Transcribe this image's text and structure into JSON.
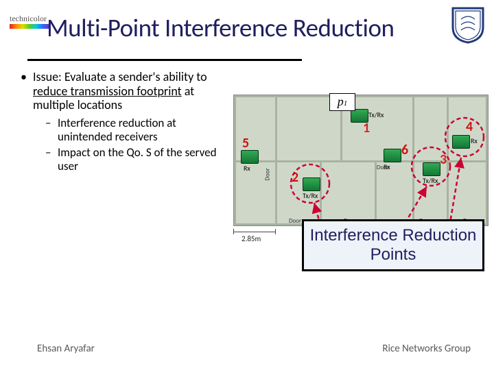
{
  "brand": {
    "tc": "technicolor"
  },
  "title": "Multi-Point Interference Reduction",
  "bullet": {
    "lead": "Issue: Evaluate a sender's ability to ",
    "under1": "reduce transmission footprint",
    "tail": " at multiple locations",
    "sub1": "Interference reduction at unintended receivers",
    "sub2": "Impact on the Qo. S of the served user"
  },
  "nodes": {
    "n1": "1",
    "n2": "2",
    "n3": "3",
    "n4": "4",
    "n5": "5",
    "n6": "6",
    "txrx": "Tx/Rx",
    "rx": "Rx",
    "door": "Door"
  },
  "scale": "2.85m",
  "p1": "p",
  "p1sub": "1",
  "irp": "Interference Reduction Points",
  "footer": {
    "left": "Ehsan Aryafar",
    "right": "Rice Networks Group"
  }
}
